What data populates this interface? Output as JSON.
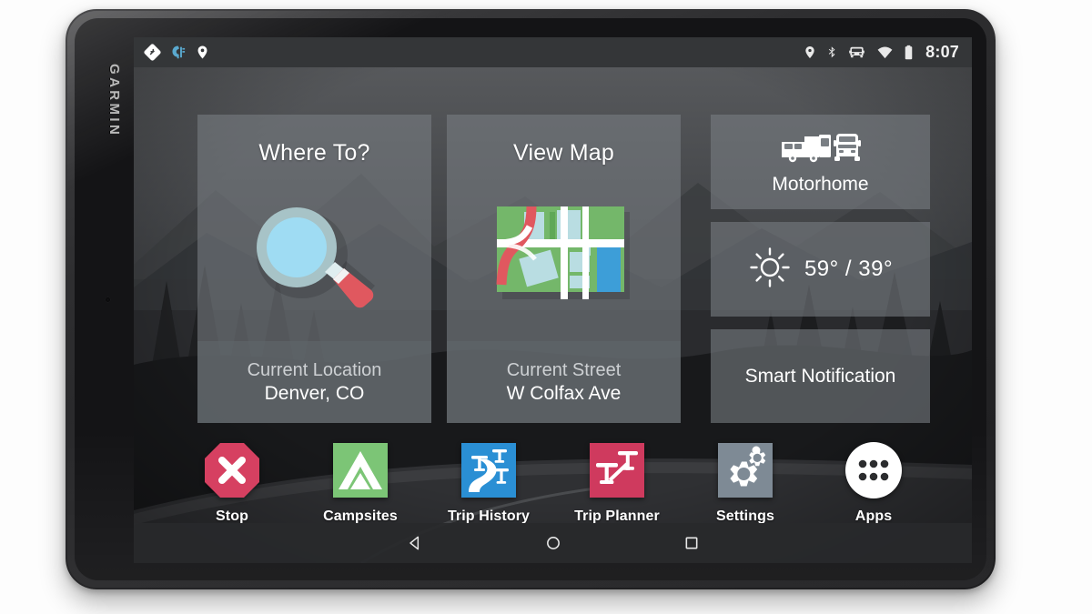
{
  "device": {
    "brand": "GARMIN"
  },
  "status_bar": {
    "left_icons": [
      "navigation-arrow-icon",
      "garmin-drive-icon",
      "location-pin-icon"
    ],
    "right_icons": [
      "location-pin-icon",
      "bluetooth-icon",
      "vehicle-icon",
      "wifi-icon",
      "battery-icon"
    ],
    "clock": "8:07",
    "background": "#343638"
  },
  "home": {
    "cards": [
      {
        "id": "where-to",
        "title": "Where To?",
        "icon": "magnifier-icon",
        "footer_label": "Current Location",
        "footer_value": "Denver, CO"
      },
      {
        "id": "view-map",
        "title": "View Map",
        "icon": "map-icon",
        "footer_label": "Current Street",
        "footer_value": "W Colfax Ave"
      }
    ],
    "side_cards": [
      {
        "id": "vehicle-profile",
        "label": "Motorhome",
        "icon": "motorhome-icon"
      },
      {
        "id": "weather",
        "label": "59° / 39°",
        "icon": "sun-icon"
      },
      {
        "id": "smart-notification",
        "label": "Smart Notification",
        "icon": "none"
      }
    ],
    "apps": [
      {
        "id": "stop",
        "label": "Stop",
        "icon": "stop-octagon-icon",
        "color": "#d64061"
      },
      {
        "id": "campsites",
        "label": "Campsites",
        "icon": "tent-icon",
        "color": "#7cc576"
      },
      {
        "id": "trip-history",
        "label": "Trip History",
        "icon": "road-pins-icon",
        "color": "#2a8fd4"
      },
      {
        "id": "trip-planner",
        "label": "Trip Planner",
        "icon": "two-pins-icon",
        "color": "#cf3a5e"
      },
      {
        "id": "settings",
        "label": "Settings",
        "icon": "gears-icon",
        "color": "#7e8a95"
      },
      {
        "id": "apps",
        "label": "Apps",
        "icon": "app-drawer-icon",
        "color": "#ffffff"
      }
    ]
  },
  "nav_bar": {
    "buttons": [
      {
        "id": "back",
        "icon": "back-triangle-icon"
      },
      {
        "id": "home",
        "icon": "home-circle-icon"
      },
      {
        "id": "recents",
        "icon": "recents-square-icon"
      }
    ]
  },
  "colors": {
    "card_fill": "#787d82",
    "card_footer_fill": "#60656b",
    "status_bar": "#343638",
    "accent_blue": "#2a8fd4",
    "accent_red": "#d64061",
    "accent_green": "#7cc576"
  }
}
